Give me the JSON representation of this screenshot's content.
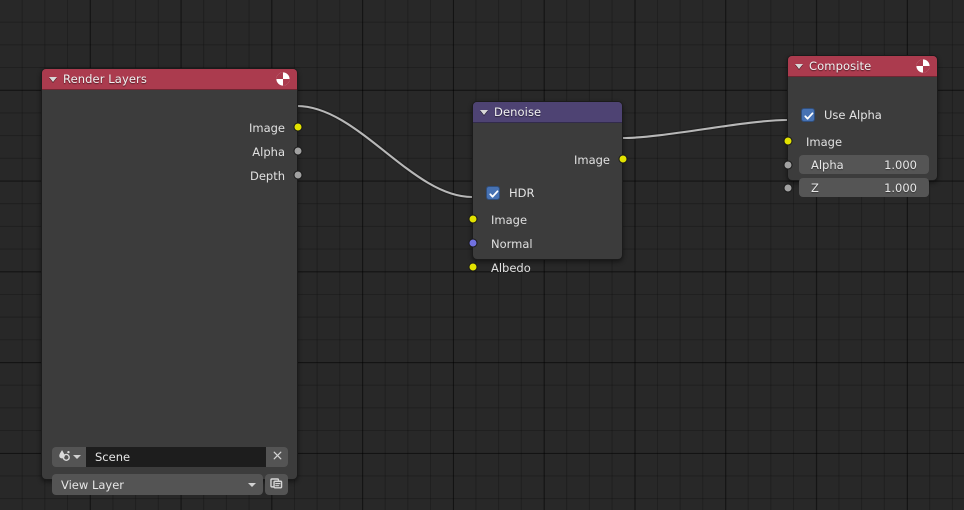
{
  "app": {
    "editor": "blender-compositor-node-editor",
    "background_color": "#282828",
    "grid_minor_color": "#232323",
    "grid_major_color": "#1f1f1f"
  },
  "colors": {
    "header_output_red": "#ab3b4e",
    "header_filter_purple": "#4e4373",
    "node_body": "#3c3c3c",
    "socket_image_yellow": "#e2e200",
    "socket_value_grey": "#a1a1a1",
    "socket_vector_blue": "#7171e0",
    "checkbox_blue": "#4772b3",
    "noodle": "#b8b8b8",
    "field_grey": "#555555",
    "text_field_dark": "#1d1d1d"
  },
  "nodes": [
    {
      "id": "render-layers",
      "title": "Render Layers",
      "header_color": "#ab3b4e",
      "header_icon": "render-result-icon",
      "collapse_icon": "collapse-triangle-icon",
      "outputs": [
        {
          "label": "Image",
          "socket": "yellow"
        },
        {
          "label": "Alpha",
          "socket": "grey"
        },
        {
          "label": "Depth",
          "socket": "grey"
        }
      ],
      "scene_field": {
        "icon": "scene-data-icon",
        "dropdown_icon": "chevron-down-icon",
        "value": "Scene",
        "clear_label": "×",
        "clear_icon": "close-x-icon"
      },
      "view_layer_field": {
        "value": "View Layer",
        "dropdown_icon": "chevron-down-icon",
        "new_icon": "duplicate-view-layer-icon"
      }
    },
    {
      "id": "denoise",
      "title": "Denoise",
      "header_color": "#4e4373",
      "collapse_icon": "collapse-triangle-icon",
      "outputs": [
        {
          "label": "Image",
          "socket": "yellow"
        }
      ],
      "options": [
        {
          "label": "HDR",
          "checked": true,
          "icon": "checkbox-checked-icon"
        }
      ],
      "inputs": [
        {
          "label": "Image",
          "socket": "yellow"
        },
        {
          "label": "Normal",
          "socket": "blue"
        },
        {
          "label": "Albedo",
          "socket": "yellow"
        }
      ]
    },
    {
      "id": "composite",
      "title": "Composite",
      "header_color": "#ab3b4e",
      "header_icon": "render-result-icon",
      "collapse_icon": "collapse-triangle-icon",
      "options": [
        {
          "label": "Use Alpha",
          "checked": true,
          "icon": "checkbox-checked-icon"
        }
      ],
      "inputs": [
        {
          "label": "Image",
          "socket": "yellow",
          "type": "socket-only"
        },
        {
          "label": "Alpha",
          "socket": "grey",
          "type": "value",
          "value": "1.000"
        },
        {
          "label": "Z",
          "socket": "grey",
          "type": "value",
          "value": "1.000"
        }
      ]
    }
  ],
  "links": [
    {
      "from": "render-layers.Image",
      "to": "denoise.Image",
      "color": "#b8b8b8"
    },
    {
      "from": "denoise.Image",
      "to": "composite.Image",
      "color": "#b8b8b8"
    }
  ]
}
